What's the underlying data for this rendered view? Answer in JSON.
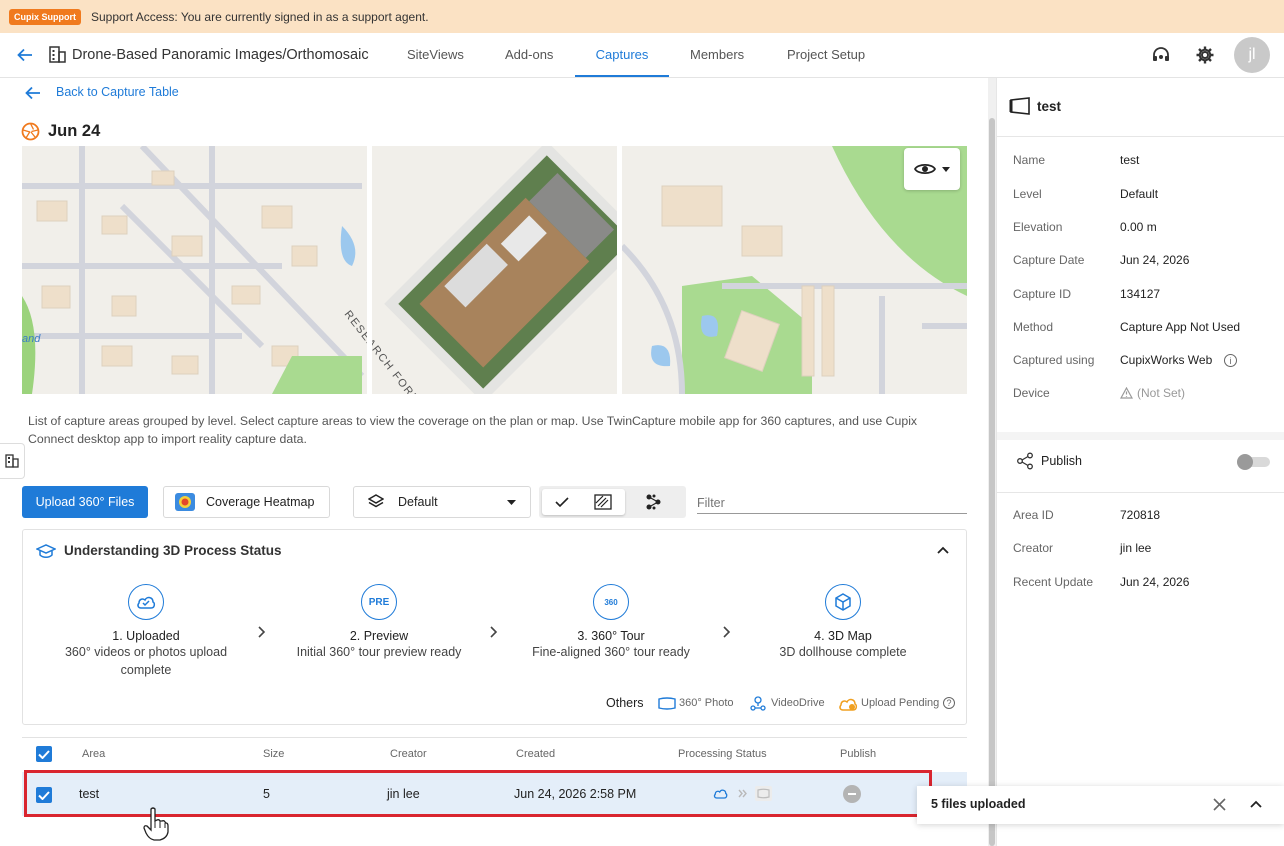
{
  "banner": {
    "tag": "Cupix Support",
    "message": "Support Access: You are currently signed in as a support agent."
  },
  "nav": {
    "project_title": "Drone-Based Panoramic Images/Orthomosaic",
    "tabs": [
      "SiteViews",
      "Add-ons",
      "Captures",
      "Members",
      "Project Setup"
    ],
    "active_tab": "Captures",
    "avatar_initials": "jl"
  },
  "capture": {
    "back_label": "Back to Capture Table",
    "title": "Jun 24",
    "map_street_label": "RESEARCH FORE",
    "map_edge_label": "and"
  },
  "main": {
    "description": "List of capture areas grouped by level. Select capture areas to view the coverage on the plan or map. Use TwinCapture mobile app for 360 captures, and use Cupix Connect desktop app to import reality capture data.",
    "upload_button": "Upload 360° Files",
    "heatmap_button": "Coverage Heatmap",
    "level_select": "Default",
    "filter_placeholder": "Filter"
  },
  "process": {
    "title": "Understanding 3D Process Status",
    "steps": [
      {
        "title": "1. Uploaded",
        "desc": "360° videos or photos upload complete"
      },
      {
        "title": "2. Preview",
        "desc": "Initial 360° tour preview ready",
        "badge": "PRE"
      },
      {
        "title": "3. 360° Tour",
        "desc": "Fine-aligned 360° tour ready",
        "badge": "360"
      },
      {
        "title": "4. 3D Map",
        "desc": "3D dollhouse complete"
      }
    ],
    "others_label": "Others",
    "legend": [
      "360° Photo",
      "VideoDrive",
      "Upload Pending"
    ]
  },
  "table": {
    "headers": [
      "Area",
      "Size",
      "Creator",
      "Created",
      "Processing Status",
      "Publish"
    ],
    "rows": [
      {
        "area": "test",
        "size": "5",
        "creator": "jin lee",
        "created": "Jun 24, 2026 2:58 PM"
      }
    ]
  },
  "toast": {
    "message": "5 files uploaded"
  },
  "panel": {
    "name_header": "test",
    "properties": [
      {
        "label": "Name",
        "value": "test"
      },
      {
        "label": "Level",
        "value": "Default"
      },
      {
        "label": "Elevation",
        "value": "0.00 m"
      },
      {
        "label": "Capture Date",
        "value": "Jun 24, 2026"
      },
      {
        "label": "Capture ID",
        "value": "134127"
      },
      {
        "label": "Method",
        "value": "Capture App Not Used"
      },
      {
        "label": "Captured using",
        "value": "CupixWorks Web"
      },
      {
        "label": "Device",
        "value": "(Not Set)"
      }
    ],
    "publish_label": "Publish",
    "publish_on": false,
    "meta": [
      {
        "label": "Area ID",
        "value": "720818"
      },
      {
        "label": "Creator",
        "value": "jin lee"
      },
      {
        "label": "Recent Update",
        "value": "Jun 24, 2026"
      }
    ]
  },
  "colors": {
    "accent": "#1f7bd8",
    "banner_bg": "#fbe2c4",
    "support_tag": "#f07a1e",
    "selection_outline": "#d9252f",
    "row_selected": "#e4eef9"
  }
}
